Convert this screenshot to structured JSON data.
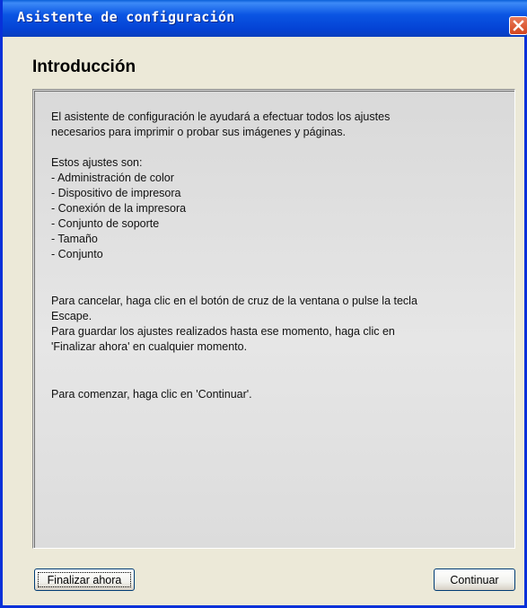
{
  "window": {
    "title": "Asistente de configuración"
  },
  "page": {
    "heading": "Introducción"
  },
  "content": {
    "intro_lines": [
      "El asistente de configuración le ayudará a efectuar todos los ajustes",
      "necesarios para imprimir o probar sus imágenes y páginas."
    ],
    "settings_heading": "Estos ajustes son:",
    "settings_items": [
      "- Administración de color",
      "- Dispositivo de impresora",
      "- Conexión de la impresora",
      "- Conjunto de soporte",
      "- Tamaño",
      "- Conjunto"
    ],
    "instructions_lines": [
      "Para cancelar, haga clic en el botón de cruz de la ventana o pulse la tecla",
      "Escape.",
      "Para guardar los ajustes realizados hasta ese momento, haga clic en",
      "'Finalizar ahora' en cualquier momento."
    ],
    "start_line": "Para comenzar, haga clic en 'Continuar'."
  },
  "buttons": {
    "finalize_label": "Finalizar ahora",
    "continue_label": "Continuar"
  },
  "colors": {
    "titlebar": "#0a55e3",
    "close_button": "#d2451d",
    "dialog_background": "#ece9d8",
    "panel_background": "#e3e3e3"
  },
  "icons": {
    "close": "close-icon"
  }
}
